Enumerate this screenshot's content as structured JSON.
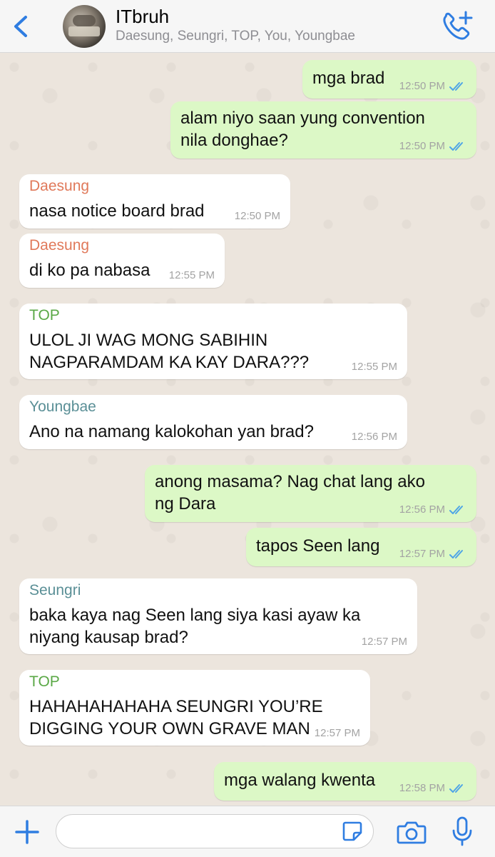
{
  "header": {
    "title": "ITbruh",
    "subtitle": "Daesung, Seungri, TOP, You, Youngbae",
    "back_icon": "chevron-left-icon",
    "call_icon": "phone-add-icon"
  },
  "colors": {
    "accent": "#2f7de1",
    "outgoing_bubble": "#dcf8c6",
    "incoming_bubble": "#ffffff",
    "chat_background": "#ece5dd",
    "sender_daesung": "#e0795a",
    "sender_top": "#5aa846",
    "sender_youngbae": "#5a8f96",
    "sender_seungri": "#5a8f96",
    "read_ticks": "#4fa5e6"
  },
  "messages": [
    {
      "direction": "out",
      "text": "mga brad",
      "time": "12:50 PM",
      "status": "read"
    },
    {
      "direction": "out",
      "text": "alam niyo saan yung convention\nnila donghae?",
      "time": "12:50 PM",
      "status": "read"
    },
    {
      "direction": "in",
      "sender": "Daesung",
      "text": "nasa notice board brad",
      "time": "12:50 PM"
    },
    {
      "direction": "in",
      "sender": "Daesung",
      "text": "di ko pa nabasa",
      "time": "12:55 PM"
    },
    {
      "direction": "in",
      "sender": "TOP",
      "text": "ULOL JI WAG MONG SABIHIN\nNAGPARAMDAM KA KAY DARA???",
      "time": "12:55 PM"
    },
    {
      "direction": "in",
      "sender": "Youngbae",
      "text": "Ano na namang kalokohan yan brad?",
      "time": "12:56 PM"
    },
    {
      "direction": "out",
      "text": "anong masama? Nag chat lang ako\nng Dara",
      "time": "12:56 PM",
      "status": "read"
    },
    {
      "direction": "out",
      "text": "tapos Seen lang",
      "time": "12:57 PM",
      "status": "read"
    },
    {
      "direction": "in",
      "sender": "Seungri",
      "text": "baka kaya nag Seen lang siya kasi ayaw ka\nniyang kausap brad?",
      "time": "12:57 PM"
    },
    {
      "direction": "in",
      "sender": "TOP",
      "text": "HAHAHAHAHAHA SEUNGRI YOU’RE\nDIGGING YOUR OWN GRAVE MAN",
      "time": "12:57 PM"
    },
    {
      "direction": "out",
      "text": "mga walang kwenta",
      "time": "12:58 PM",
      "status": "read"
    }
  ],
  "footer": {
    "input_value": "",
    "icons": [
      "plus-icon",
      "sticker-icon",
      "camera-icon",
      "microphone-icon"
    ]
  }
}
